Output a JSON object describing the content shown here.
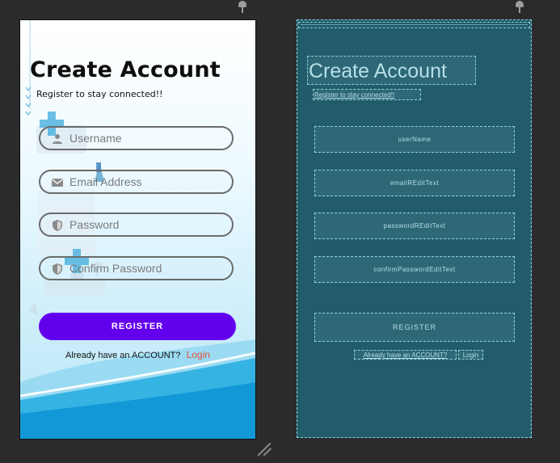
{
  "design": {
    "title": "Create Account",
    "subtitle": "Register to stay connected!!",
    "fields": [
      {
        "placeholder": "Username",
        "icon": "person-icon"
      },
      {
        "placeholder": "Email Address",
        "icon": "email-icon"
      },
      {
        "placeholder": "Password",
        "icon": "shield-icon"
      },
      {
        "placeholder": "Confirm Password",
        "icon": "shield-icon"
      }
    ],
    "register_label": "REGISTER",
    "login_prompt": "Already have an ACCOUNT?",
    "login_link": "Login"
  },
  "blueprint": {
    "title": "Create Account",
    "subtitle": "Register to stay connected!!",
    "fields": [
      "userName",
      "emailREditText",
      "passwordREditText",
      "confirmPasswordEditText"
    ],
    "register_label": "REGISTER",
    "login_prompt": "Already have an ACCOUNT?",
    "login_link": "Login"
  },
  "colors": {
    "primary": "#6200ee",
    "link": "#e0523a",
    "blueprint_bg": "#225c6b",
    "blueprint_line": "#8ed3de"
  }
}
